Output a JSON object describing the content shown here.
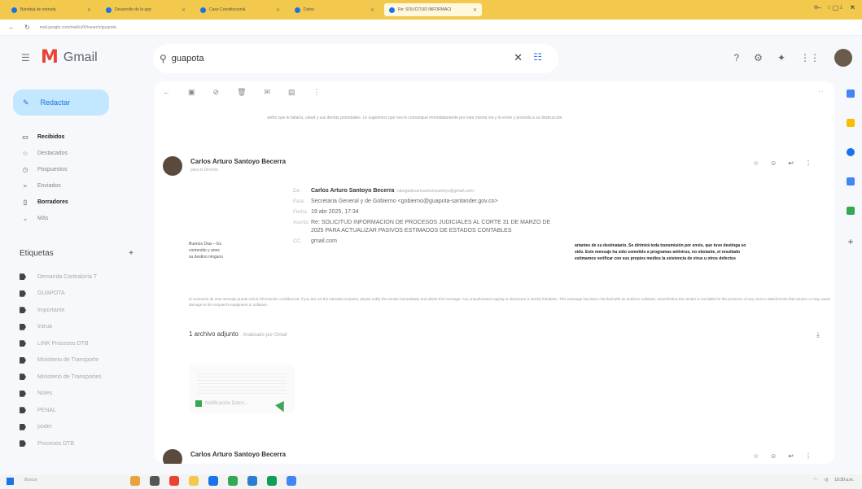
{
  "browser": {
    "tabs": [
      {
        "label": "Bandeja de entrada",
        "active": false
      },
      {
        "label": "Desarrollo de la app",
        "active": false
      },
      {
        "label": "Caso Constitucional",
        "active": false
      },
      {
        "label": "Datos",
        "active": false
      },
      {
        "label": "Re: SOLICITUD INFORMACI",
        "active": true
      }
    ],
    "url": "mail.google.com/mail/u/0/#search/guapota"
  },
  "gmail": {
    "logo_text": "Gmail",
    "search_value": "guapota",
    "compose_label": "Redactar",
    "nav": [
      {
        "label": "Recibidos",
        "bold": true,
        "icon": "inbox-icon",
        "glyph": "▭"
      },
      {
        "label": "Destacados",
        "bold": false,
        "icon": "star-icon",
        "glyph": "☆"
      },
      {
        "label": "Pospuestos",
        "bold": false,
        "icon": "clock-icon",
        "glyph": "◷"
      },
      {
        "label": "Enviados",
        "bold": false,
        "icon": "send-icon",
        "glyph": "➢"
      },
      {
        "label": "Borradores",
        "bold": true,
        "icon": "draft-icon",
        "glyph": "▯"
      },
      {
        "label": "Más",
        "bold": false,
        "icon": "chevron-down-icon",
        "glyph": "⌄"
      }
    ],
    "labels_title": "Etiquetas",
    "labels_add": "+",
    "labels": [
      "Demanda Contraloría T",
      "GUAPOTA",
      "Importante",
      "Intrua",
      "LINK Procesos DTB",
      "Ministerio de Transporte",
      "Ministerio de Transportes",
      "Notes",
      "PENAL",
      "poder",
      "Procesos DTB"
    ]
  },
  "thread": {
    "quoted_top": "señor que le faltaría, usted y sus demás prioridades. Le sugerimos que nos lo comunique inmediatamente por esta misma vía y lo envíe y proceda a su destrucción",
    "message1": {
      "sender": "Carlos Arturo Santoyo Becerra",
      "to": "para el Director"
    },
    "forwarded": {
      "sender": "Carlos Arturo Santoyo Becerra",
      "sender_email": "<abogadocarlosarturosantoyo@gmail.com>",
      "to": "Secretaria General y de Gobierno <gobierno@guapota-santander.gov.co>",
      "date": "19 abr 2025, 17:34",
      "subject": "Re: SOLICITUD INFORMACION DE PROCESOS JUDICIALES AL CORTE 31 DE MARZO DE 2025 PARA ACTUALIZAR PASIVOS ESTIMADOS DE ESTADOS CONTABLES",
      "cc": "gmail.com"
    },
    "left_snippet": [
      "Buenos Días – Es",
      "contenido y anex",
      "su destino ninguno"
    ],
    "right_snippet": [
      "ariantes de su destinatario. Se dirimirá toda transmisión por envío, que tuvo destinga so",
      "sido. Este mensaje ha sido sometido a programas antivirus, no obstante, el resultado",
      "estimamos verificar con sus propios medios la existencia de virus u otros defectos"
    ],
    "disclaimer": "el contenido de este mensaje puede incluir información confidencial. If you are not the intended recipient, please notify the sender immediately and delete this message. Any unauthorised copying or disclosure is strictly forbidden. This message has been checked with an antivirus software; nevertheless the sender is not liable for the presence of any virus in attachments that causes or may cause damage to the recipient's equipment or software.",
    "attachment_title": "1 archivo adjunto",
    "attachment_sub": "· Analizado por Gmail",
    "attachment_name": "Notificación Datos...",
    "message2": {
      "sender": "Carlos Arturo Santoyo Becerra"
    }
  },
  "taskbar": {
    "search": "Buscar",
    "time": "10:30 a.m."
  }
}
